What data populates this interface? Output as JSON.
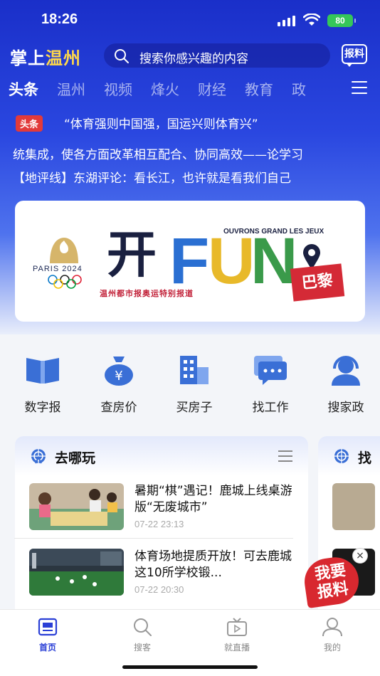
{
  "status_bar": {
    "time": "18:26",
    "battery": "80"
  },
  "header": {
    "logo_part1": "掌上",
    "logo_part2": "温州",
    "search_placeholder": "搜索你感兴趣的内容",
    "report_label": "报料"
  },
  "tabs": [
    "头条",
    "温州",
    "视频",
    "烽火",
    "财经",
    "教育",
    "政"
  ],
  "headlines": {
    "tag": "头条",
    "line1": "“体育强则中国强，国运兴则体育兴”",
    "line2": "统集成，使各方面改革相互配合、协同高效——论学习",
    "line3": "【地评线】东湖评论：看长江，也许就是看我们自己"
  },
  "banner": {
    "paris_text": "PARIS 2024",
    "kai": "开",
    "fun": [
      "F",
      "U",
      "N"
    ],
    "ouvrons": "OUVRONS GRAND LES JEUX",
    "bali": "巴黎",
    "subtitle": "温州都市报奥运特别报道"
  },
  "quick_links": [
    {
      "label": "数字报",
      "icon": "newspaper-book-icon"
    },
    {
      "label": "查房价",
      "icon": "money-bag-icon"
    },
    {
      "label": "买房子",
      "icon": "building-icon"
    },
    {
      "label": "找工作",
      "icon": "chat-bubbles-icon"
    },
    {
      "label": "搜家政",
      "icon": "headset-person-icon"
    }
  ],
  "card": {
    "title": "去哪玩",
    "items": [
      {
        "title": "暑期“棋”遇记！鹿城上线桌游版“无废城市”",
        "time": "07-22 23:13"
      },
      {
        "title": "体育场地提质开放！可去鹿城这10所学校锻...",
        "time": "07-22 20:30"
      }
    ]
  },
  "card2": {
    "title": "找"
  },
  "float_report": {
    "label_line1": "我要",
    "label_line2": "报料",
    "close": "×"
  },
  "bottom_nav": [
    {
      "label": "首页",
      "icon": "home-newspaper-icon",
      "active": true
    },
    {
      "label": "搜客",
      "icon": "search-icon"
    },
    {
      "label": "就直播",
      "icon": "tv-play-icon"
    },
    {
      "label": "我的",
      "icon": "user-icon"
    }
  ],
  "colors": {
    "brand_blue": "#2a3fd6",
    "accent_red": "#d8282f",
    "logo_yellow": "#ffd84a"
  }
}
